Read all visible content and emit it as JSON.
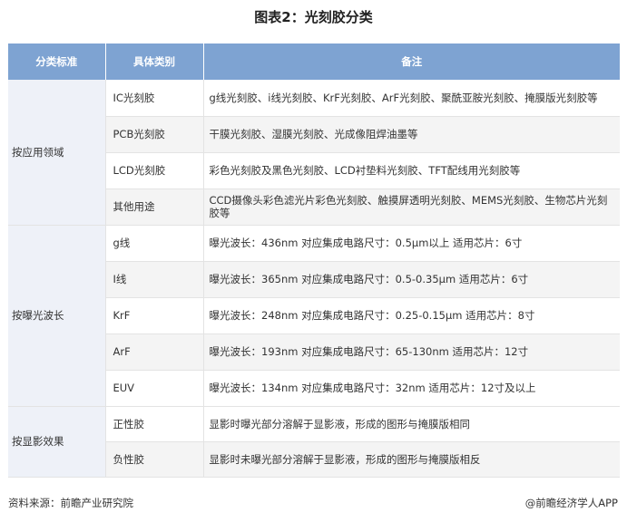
{
  "title": "图表2：光刻胶分类",
  "header": {
    "col1": "分类标准",
    "col2": "具体类别",
    "col3": "备注"
  },
  "groups": [
    {
      "name": "按应用领域",
      "rows": [
        {
          "type": "IC光刻胶",
          "note": "g线光刻胶、i线光刻胶、KrF光刻胶、ArF光刻胶、聚酰亚胺光刻胶、掩膜版光刻胶等"
        },
        {
          "type": "PCB光刻胶",
          "note": "干膜光刻胶、湿膜光刻胶、光成像阻焊油墨等"
        },
        {
          "type": "LCD光刻胶",
          "note": "彩色光刻胶及黑色光刻胶、LCD衬垫料光刻胶、TFT配线用光刻胶等"
        },
        {
          "type": "其他用途",
          "note": "CCD摄像头彩色滤光片彩色光刻胶、触摸屏透明光刻胶、MEMS光刻胶、生物芯片光刻胶等"
        }
      ]
    },
    {
      "name": "按曝光波长",
      "rows": [
        {
          "type": "g线",
          "note": "曝光波长：436nm 对应集成电路尺寸：0.5μm以上 适用芯片：6寸"
        },
        {
          "type": "I线",
          "note": "曝光波长：365nm 对应集成电路尺寸：0.5-0.35μm 适用芯片：6寸"
        },
        {
          "type": "KrF",
          "note": "曝光波长：248nm 对应集成电路尺寸：0.25-0.15μm 适用芯片：8寸"
        },
        {
          "type": "ArF",
          "note": "曝光波长：193nm 对应集成电路尺寸：65-130nm 适用芯片：12寸"
        },
        {
          "type": "EUV",
          "note": "曝光波长：134nm 对应集成电路尺寸：32nm 适用芯片：12寸及以上"
        }
      ]
    },
    {
      "name": "按显影效果",
      "rows": [
        {
          "type": "正性胶",
          "note": "显影时曝光部分溶解于显影液，形成的图形与掩膜版相同"
        },
        {
          "type": "负性胶",
          "note": "显影时未曝光部分溶解于显影液，形成的图形与掩膜版相反"
        }
      ]
    }
  ],
  "footer": {
    "source": "资料来源：前瞻产业研究院",
    "brand": "@前瞻经济学人APP"
  },
  "colors": {
    "header_bg": "#7ea3d2",
    "category_bg": "#eef1f8",
    "stripe_bg": "#f4f4f4"
  }
}
